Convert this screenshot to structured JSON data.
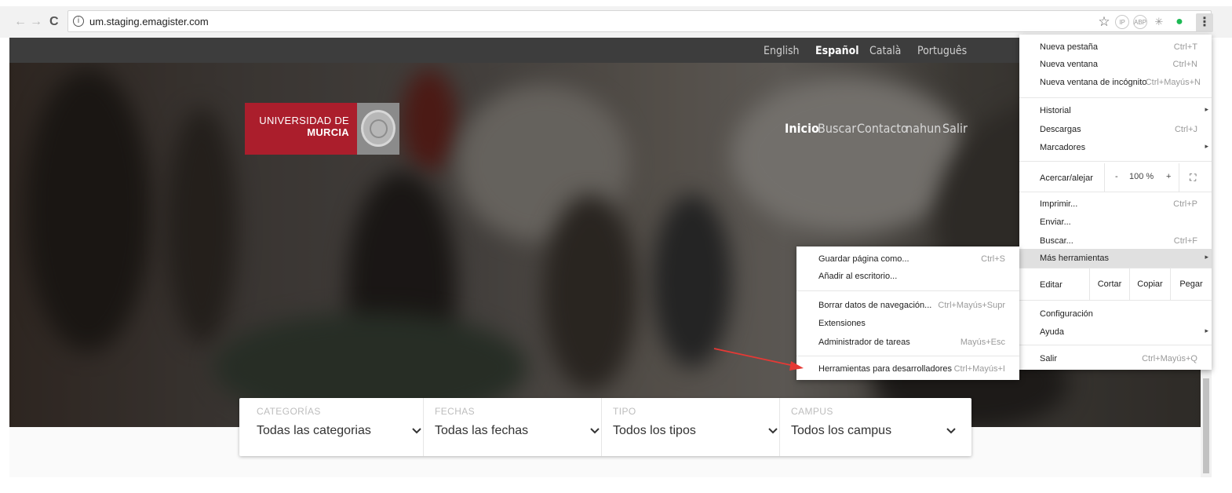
{
  "browser": {
    "url": "um.staging.emagister.com",
    "back_icon": "←",
    "forward_icon": "→",
    "reload_icon": "C",
    "extensions": [
      "☆",
      "IP",
      "ABP",
      "✳",
      "●"
    ],
    "menu_icon": "⋮"
  },
  "site": {
    "languages": [
      "English",
      "Español",
      "Català",
      "Português"
    ],
    "active_language": "Español",
    "logo_line1": "UNIVERSIDAD DE",
    "logo_line2": "MURCIA",
    "nav": [
      "Inicio",
      "Buscar",
      "Contacto",
      "nahun",
      "Salir"
    ],
    "active_nav": "Inicio",
    "filters": [
      {
        "label": "CATEGORÍAS",
        "value": "Todas las categorias"
      },
      {
        "label": "FECHAS",
        "value": "Todas las fechas"
      },
      {
        "label": "TIPO",
        "value": "Todos los tipos"
      },
      {
        "label": "CAMPUS",
        "value": "Todos los campus"
      }
    ]
  },
  "chrome_menu": {
    "new_tab": {
      "label": "Nueva pestaña",
      "shortcut": "Ctrl+T"
    },
    "new_window": {
      "label": "Nueva ventana",
      "shortcut": "Ctrl+N"
    },
    "incognito": {
      "label": "Nueva ventana de incógnito",
      "shortcut": "Ctrl+Mayús+N"
    },
    "history": {
      "label": "Historial",
      "arrow": "▸"
    },
    "downloads": {
      "label": "Descargas",
      "shortcut": "Ctrl+J"
    },
    "bookmarks": {
      "label": "Marcadores",
      "arrow": "▸"
    },
    "zoom": {
      "label": "Acercar/alejar",
      "minus": "-",
      "value": "100 %",
      "plus": "+",
      "fullscreen": "⛶"
    },
    "print": {
      "label": "Imprimir...",
      "shortcut": "Ctrl+P"
    },
    "send": {
      "label": "Enviar..."
    },
    "find": {
      "label": "Buscar...",
      "shortcut": "Ctrl+F"
    },
    "more_tools": {
      "label": "Más herramientas",
      "arrow": "▸"
    },
    "edit": {
      "label": "Editar",
      "cut": "Cortar",
      "copy": "Copiar",
      "paste": "Pegar"
    },
    "settings": {
      "label": "Configuración"
    },
    "help": {
      "label": "Ayuda",
      "arrow": "▸"
    },
    "exit": {
      "label": "Salir",
      "shortcut": "Ctrl+Mayús+Q"
    }
  },
  "more_tools_menu": {
    "save_page": {
      "label": "Guardar página como...",
      "shortcut": "Ctrl+S"
    },
    "add_desktop": {
      "label": "Añadir al escritorio..."
    },
    "clear_data": {
      "label": "Borrar datos de navegación...",
      "shortcut": "Ctrl+Mayús+Supr"
    },
    "extensions": {
      "label": "Extensiones"
    },
    "task_manager": {
      "label": "Administrador de tareas",
      "shortcut": "Mayús+Esc"
    },
    "dev_tools": {
      "label": "Herramientas para desarrolladores",
      "shortcut": "Ctrl+Mayús+I"
    }
  },
  "colors": {
    "brand_red": "#ab1e2c",
    "annotation_arrow": "#e53935"
  }
}
